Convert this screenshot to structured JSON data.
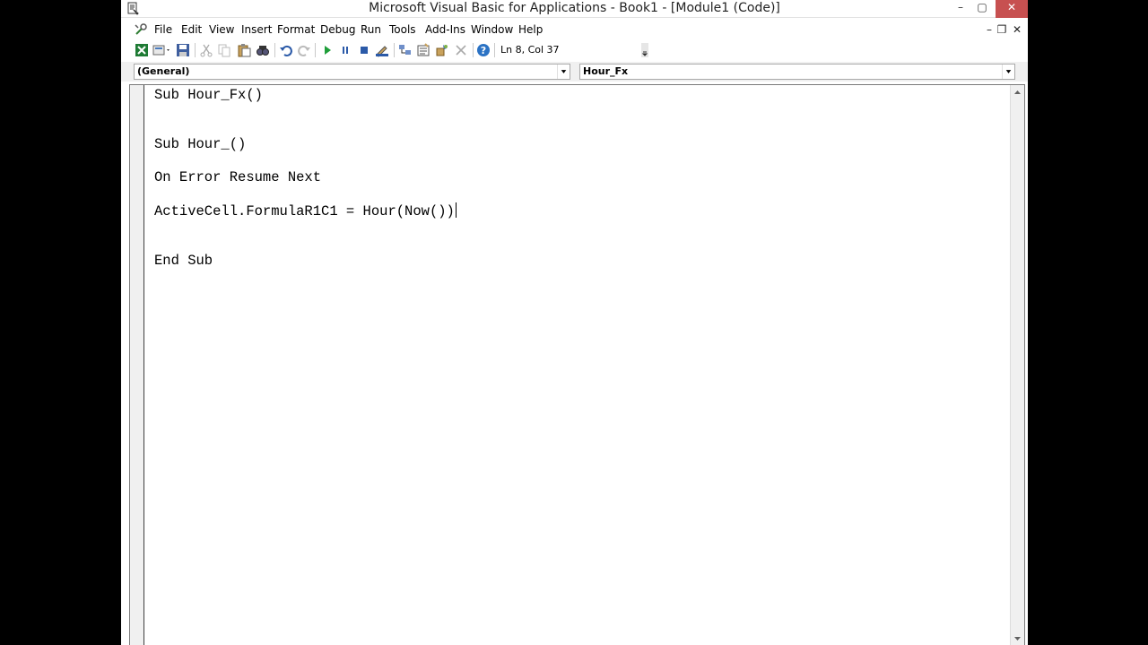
{
  "window": {
    "title": "Microsoft Visual Basic for Applications - Book1 - [Module1 (Code)]",
    "icon": "vba-app-icon",
    "controls": {
      "minimize": "–",
      "maximize": "▢",
      "close": "✕"
    }
  },
  "menubar": {
    "items": [
      {
        "label": "File"
      },
      {
        "label": "Edit"
      },
      {
        "label": "View"
      },
      {
        "label": "Insert"
      },
      {
        "label": "Format"
      },
      {
        "label": "Debug"
      },
      {
        "label": "Run"
      },
      {
        "label": "Tools"
      },
      {
        "label": "Add-Ins"
      },
      {
        "label": "Window"
      },
      {
        "label": "Help"
      }
    ],
    "mdi_controls": {
      "minimize": "–",
      "restore": "❐",
      "close": "✕"
    }
  },
  "toolbar": {
    "icons": [
      "excel-view-icon",
      "insert-module-icon",
      "save-icon",
      "cut-icon",
      "copy-icon",
      "paste-icon",
      "find-icon",
      "undo-icon",
      "redo-icon",
      "run-icon",
      "break-icon",
      "reset-icon",
      "design-mode-icon",
      "project-explorer-icon",
      "properties-icon",
      "object-browser-icon",
      "toolbox-icon",
      "help-icon"
    ],
    "position_text": "Ln 8, Col 37"
  },
  "combos": {
    "object": "(General)",
    "procedure": "Hour_Fx"
  },
  "code": {
    "lines": [
      "Sub Hour_Fx()",
      "Sub Hour_()",
      "On Error Resume Next",
      "ActiveCell.FormulaR1C1 = Hour(Now())",
      "End Sub"
    ]
  },
  "colors": {
    "keyword": "#00007f",
    "text": "#000000",
    "close_button": "#c75050"
  }
}
